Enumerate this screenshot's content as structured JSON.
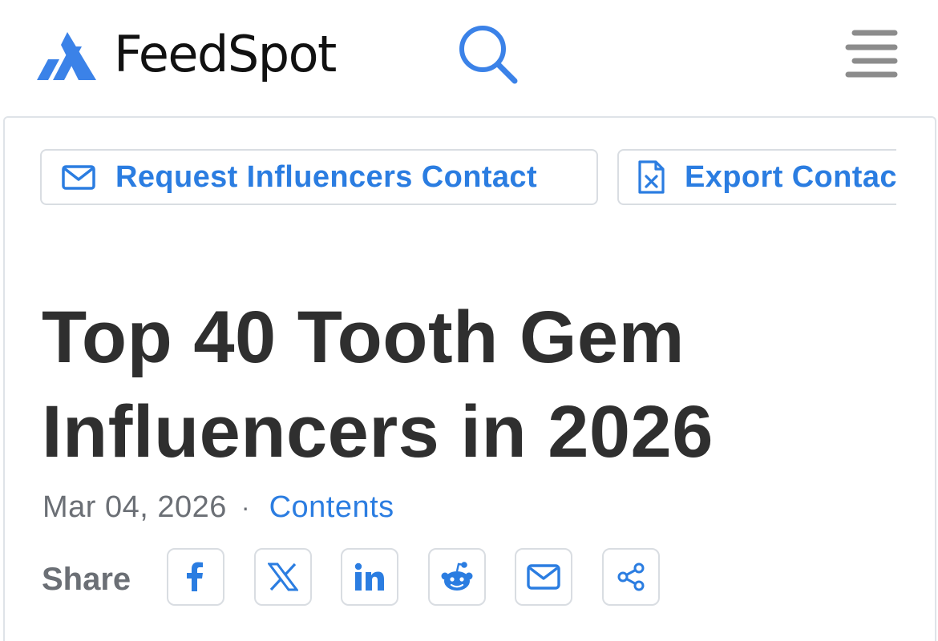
{
  "header": {
    "brand": "FeedSpot",
    "brand_color": "#3b82e8",
    "search_icon": "search-icon",
    "menu_icon": "hamburger-menu-icon"
  },
  "actions": {
    "request_label": "Request Influencers Contact",
    "request_icon": "envelope-icon",
    "export_label": "Export Contacts",
    "export_icon": "excel-file-icon"
  },
  "article": {
    "title_line1": "Top 40 Tooth Gem",
    "title_line2": "Influencers in 2026",
    "date": "Mar 04, 2026",
    "separator": "·",
    "contents_link": "Contents"
  },
  "share": {
    "label": "Share",
    "buttons": [
      {
        "icon": "facebook-icon"
      },
      {
        "icon": "x-twitter-icon"
      },
      {
        "icon": "linkedin-icon"
      },
      {
        "icon": "reddit-icon"
      },
      {
        "icon": "email-icon"
      },
      {
        "icon": "share-icon"
      }
    ]
  },
  "colors": {
    "accent": "#2b7de1",
    "title_text": "#2f2f2f",
    "muted_text": "#6b6f75",
    "border": "#d9dde2"
  }
}
